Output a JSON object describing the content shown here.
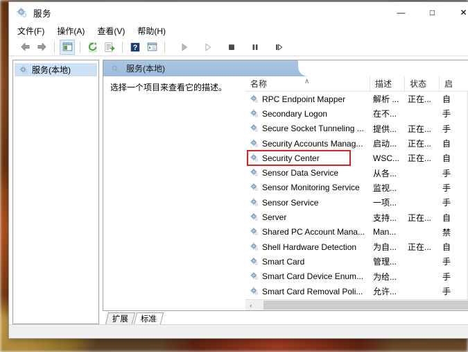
{
  "window": {
    "title": "服务",
    "icon": "services-gear-icon",
    "controls": {
      "minimize": "—",
      "maximize": "□",
      "close": "✕"
    }
  },
  "menubar": {
    "items": [
      {
        "label": "文件(F)",
        "name": "menu-file"
      },
      {
        "label": "操作(A)",
        "name": "menu-action"
      },
      {
        "label": "查看(V)",
        "name": "menu-view"
      },
      {
        "label": "帮助(H)",
        "name": "menu-help"
      }
    ]
  },
  "toolbar": {
    "buttons": [
      {
        "name": "back-button",
        "glyph": "⬅",
        "active": false
      },
      {
        "name": "forward-button",
        "glyph": "➡",
        "active": false
      },
      {
        "name": "show-hide-tree-button",
        "glyph": "▤",
        "active": true
      },
      {
        "name": "refresh-button",
        "glyph": "⟳",
        "active": false
      },
      {
        "name": "export-list-button",
        "glyph": "☷",
        "active": false
      },
      {
        "name": "help-button",
        "glyph": "?",
        "active": false
      },
      {
        "name": "properties-button",
        "glyph": "▥",
        "active": false
      },
      {
        "name": "start-service-button",
        "glyph": "▶",
        "active": false
      },
      {
        "name": "resume-service-button",
        "glyph": "▷",
        "active": false
      },
      {
        "name": "stop-service-button",
        "glyph": "■",
        "active": false
      },
      {
        "name": "pause-service-button",
        "glyph": "‖",
        "active": false
      },
      {
        "name": "restart-service-button",
        "glyph": "⏭",
        "active": false
      }
    ]
  },
  "tree": {
    "items": [
      {
        "label": "服务(本地)",
        "name": "tree-item-services-local",
        "selected": true
      }
    ]
  },
  "pane": {
    "header_title": "服务(本地)",
    "description": "选择一个项目来查看它的描述。"
  },
  "list": {
    "columns": [
      {
        "label": "名称",
        "name": "column-header-name",
        "sorted": true,
        "sort_caret": "∧"
      },
      {
        "label": "描述",
        "name": "column-header-description",
        "sorted": false
      },
      {
        "label": "状态",
        "name": "column-header-status",
        "sorted": false
      },
      {
        "label": "启",
        "name": "column-header-startup-type",
        "sorted": false
      }
    ],
    "rows": [
      {
        "name": "RPC Endpoint Mapper",
        "description": "解析 ...",
        "status": "正在...",
        "startup": "自",
        "highlighted": false
      },
      {
        "name": "Secondary Logon",
        "description": "在不...",
        "status": "",
        "startup": "手",
        "highlighted": false
      },
      {
        "name": "Secure Socket Tunneling ...",
        "description": "提供...",
        "status": "正在...",
        "startup": "手",
        "highlighted": false
      },
      {
        "name": "Security Accounts Manag...",
        "description": "启动...",
        "status": "正在...",
        "startup": "自",
        "highlighted": false
      },
      {
        "name": "Security Center",
        "description": "WSC...",
        "status": "正在...",
        "startup": "自",
        "highlighted": true
      },
      {
        "name": "Sensor Data Service",
        "description": "从各...",
        "status": "",
        "startup": "手",
        "highlighted": false
      },
      {
        "name": "Sensor Monitoring Service",
        "description": "监视...",
        "status": "",
        "startup": "手",
        "highlighted": false
      },
      {
        "name": "Sensor Service",
        "description": "一项...",
        "status": "",
        "startup": "手",
        "highlighted": false
      },
      {
        "name": "Server",
        "description": "支持...",
        "status": "正在...",
        "startup": "自",
        "highlighted": false
      },
      {
        "name": "Shared PC Account Mana...",
        "description": "Man...",
        "status": "",
        "startup": "禁",
        "highlighted": false
      },
      {
        "name": "Shell Hardware Detection",
        "description": "为自...",
        "status": "正在...",
        "startup": "自",
        "highlighted": false
      },
      {
        "name": "Smart Card",
        "description": "管理...",
        "status": "",
        "startup": "手",
        "highlighted": false
      },
      {
        "name": "Smart Card Device Enum...",
        "description": "为给...",
        "status": "",
        "startup": "手",
        "highlighted": false
      },
      {
        "name": "Smart Card Removal Poli...",
        "description": "允许...",
        "status": "",
        "startup": "手",
        "highlighted": false
      }
    ],
    "scroll": {
      "up_glyph": "∧",
      "down_glyph": "∨",
      "left_glyph": "‹",
      "right_glyph": "›"
    }
  },
  "tabs": [
    {
      "label": "扩展",
      "name": "tab-extended",
      "active": false
    },
    {
      "label": "标准",
      "name": "tab-standard",
      "active": true
    }
  ],
  "colors": {
    "highlight_box": "#e02020",
    "header_banner": "#a9c6e4",
    "tree_selection": "#cde1f5"
  }
}
